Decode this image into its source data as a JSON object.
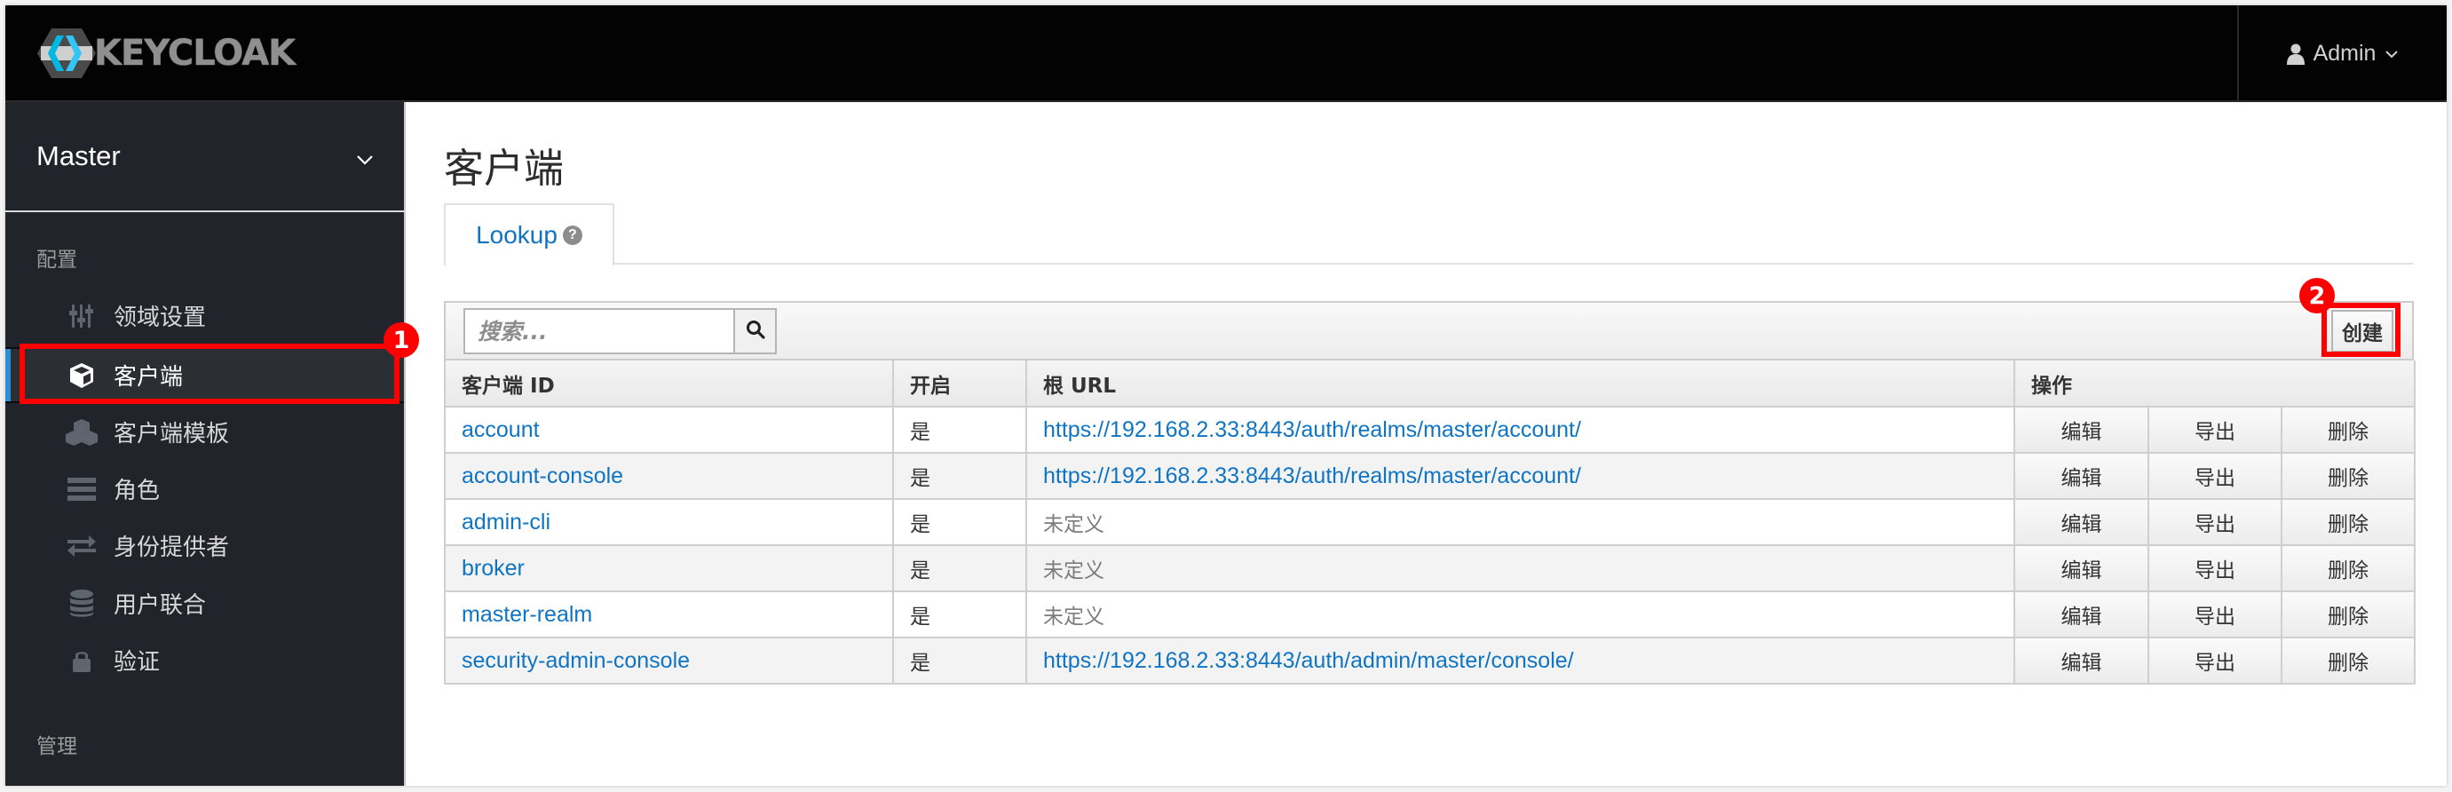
{
  "header": {
    "logo_text": "KEYCLOAK",
    "user_name": "Admin"
  },
  "sidebar": {
    "realm": "Master",
    "sections": [
      {
        "label": "配置",
        "items": [
          {
            "label": "领域设置",
            "icon": "sliders-icon",
            "active": false
          },
          {
            "label": "客户端",
            "icon": "cube-icon",
            "active": true
          },
          {
            "label": "客户端模板",
            "icon": "cubes-icon",
            "active": false
          },
          {
            "label": "角色",
            "icon": "list-icon",
            "active": false
          },
          {
            "label": "身份提供者",
            "icon": "exchange-icon",
            "active": false
          },
          {
            "label": "用户联合",
            "icon": "database-icon",
            "active": false
          },
          {
            "label": "验证",
            "icon": "lock-icon",
            "active": false
          }
        ]
      },
      {
        "label": "管理",
        "items": []
      }
    ]
  },
  "main": {
    "title": "客户端",
    "tabs": [
      {
        "label": "Lookup",
        "help_icon": "question-circle-icon"
      }
    ],
    "search": {
      "placeholder": "搜索...",
      "value": ""
    },
    "create_label": "创建",
    "table": {
      "columns": [
        "客户端 ID",
        "开启",
        "根 URL",
        "操作"
      ],
      "actions": [
        "编辑",
        "导出",
        "删除"
      ],
      "rows": [
        {
          "client_id": "account",
          "enabled": "是",
          "root_url": "https://192.168.2.33:8443/auth/realms/master/account/",
          "defined": true
        },
        {
          "client_id": "account-console",
          "enabled": "是",
          "root_url": "https://192.168.2.33:8443/auth/realms/master/account/",
          "defined": true
        },
        {
          "client_id": "admin-cli",
          "enabled": "是",
          "root_url": "未定义",
          "defined": false
        },
        {
          "client_id": "broker",
          "enabled": "是",
          "root_url": "未定义",
          "defined": false
        },
        {
          "client_id": "master-realm",
          "enabled": "是",
          "root_url": "未定义",
          "defined": false
        },
        {
          "client_id": "security-admin-console",
          "enabled": "是",
          "root_url": "https://192.168.2.33:8443/auth/admin/master/console/",
          "defined": true
        }
      ]
    }
  },
  "annotations": [
    {
      "number": "1",
      "target": "sidebar-item-clients"
    },
    {
      "number": "2",
      "target": "create-button"
    }
  ],
  "colors": {
    "link": "#0f74c4",
    "active_indicator": "#2c8fd6",
    "annotation": "#ff0000",
    "sidebar_bg": "#21252b",
    "header_bg": "#030303"
  }
}
